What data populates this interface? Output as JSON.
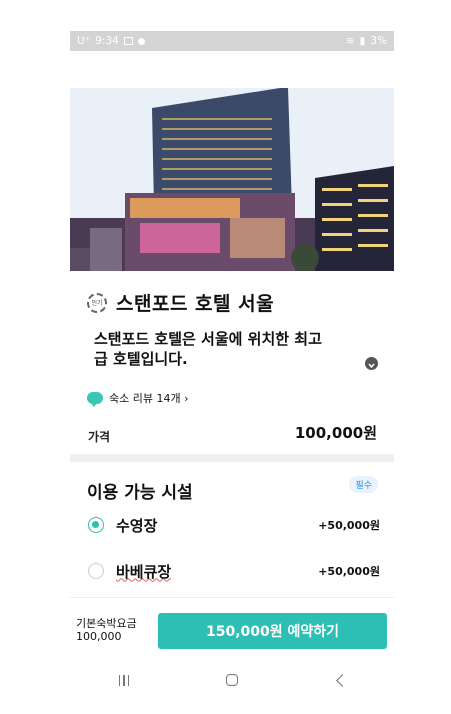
{
  "status_bar": {
    "carrier": "U⁺",
    "time": "9:34",
    "battery": "3%"
  },
  "hotel": {
    "badge": "인기",
    "name": "스탠포드 호텔 서울",
    "description": "스탠포드 호텔은 서울에 위치한 최고급 호텔입니다.",
    "review_link": "숙소 리뷰 14개 ›"
  },
  "price": {
    "label": "가격",
    "value": "100,000원"
  },
  "facilities": {
    "title": "이용 가능 시설",
    "required_label": "필수",
    "options": [
      {
        "name": "수영장",
        "price": "+50,000원",
        "selected": true
      },
      {
        "name": "바베큐장",
        "price": "+50,000원",
        "selected": false
      }
    ]
  },
  "footer": {
    "base_fare_label": "기본숙박요금",
    "base_fare_value": "100,000",
    "book_button": "150,000원 예약하기"
  },
  "colors": {
    "accent": "#2dbfb3",
    "status_bar": "#d4d4d4"
  }
}
